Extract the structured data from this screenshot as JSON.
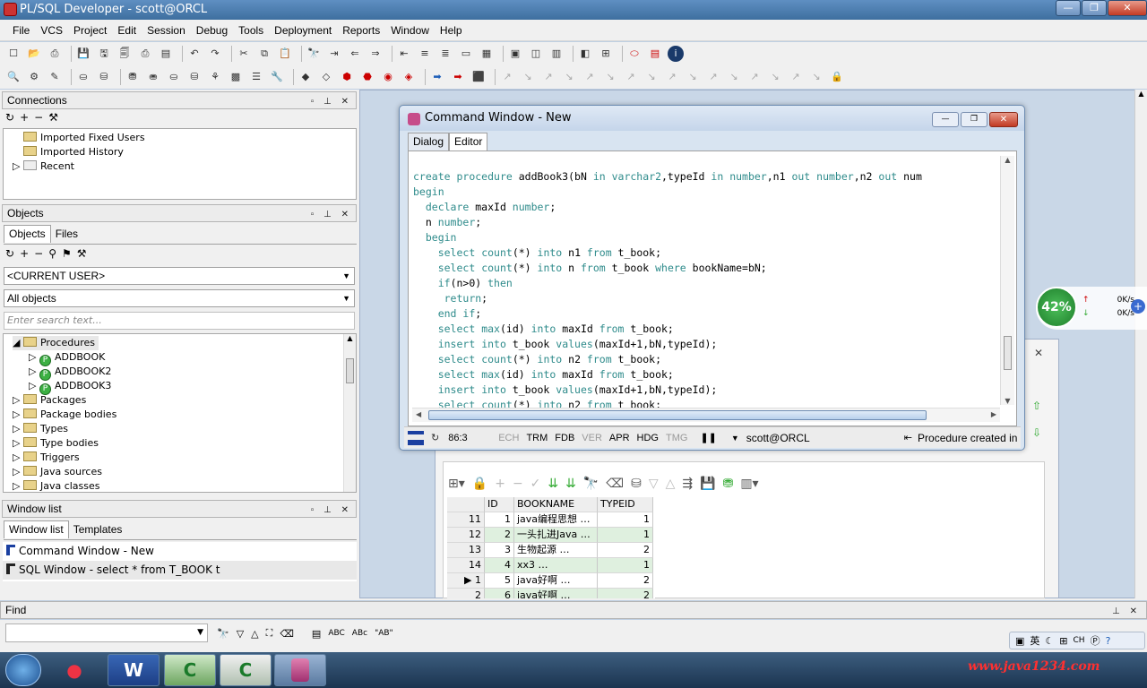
{
  "app": {
    "title": "PL/SQL Developer - scott@ORCL"
  },
  "menu": [
    "File",
    "VCS",
    "Project",
    "Edit",
    "Session",
    "Debug",
    "Tools",
    "Deployment",
    "Reports",
    "Window",
    "Help"
  ],
  "connections": {
    "title": "Connections",
    "items": [
      "Imported Fixed Users",
      "Imported History",
      "Recent"
    ]
  },
  "objects": {
    "title": "Objects",
    "tabs": [
      "Objects",
      "Files"
    ],
    "user_select": "<CURRENT USER>",
    "filter_select": "All objects",
    "search_placeholder": "Enter search text...",
    "tree": {
      "procedures": "Procedures",
      "children": [
        "ADDBOOK",
        "ADDBOOK2",
        "ADDBOOK3"
      ],
      "others": [
        "Packages",
        "Package bodies",
        "Types",
        "Type bodies",
        "Triggers",
        "Java sources",
        "Java classes"
      ]
    }
  },
  "window_list": {
    "title": "Window list",
    "tabs": [
      "Window list",
      "Templates"
    ],
    "items": [
      "Command Window - New",
      "SQL Window - select * from T_BOOK t"
    ]
  },
  "find": {
    "title": "Find",
    "buttons": [
      "ABC",
      "ABc",
      "\"AB\""
    ]
  },
  "command_window": {
    "title": "Command Window - New",
    "tabs": [
      "Dialog",
      "Editor"
    ],
    "code": [
      "create procedure addBook3(bN in varchar2,typeId in number,n1 out number,n2 out num",
      "begin",
      "  declare maxId number;",
      "  n number;",
      "  begin",
      "    select count(*) into n1 from t_book;",
      "    select count(*) into n from t_book where bookName=bN;",
      "    if(n>0) then",
      "     return;",
      "    end if;",
      "    select max(id) into maxId from t_book;",
      "    insert into t_book values(maxId+1,bN,typeId);",
      "    select count(*) into n2 from t_book;",
      "    select max(id) into maxId from t_book;",
      "    insert into t_book values(maxId+1,bN,typeId);",
      "    select count(*) into n2 from t_book;"
    ],
    "status": {
      "position": "86:3",
      "flags": [
        "ECH",
        "TRM",
        "FDB",
        "VER",
        "APR",
        "HDG",
        "TMG"
      ],
      "connection": "scott@ORCL",
      "message": "Procedure created in"
    }
  },
  "results": {
    "columns": [
      "",
      "ID",
      "BOOKNAME",
      "TYPEID"
    ],
    "rows": [
      {
        "n": "11",
        "id": "1",
        "name": "java编程思想",
        "type": "1"
      },
      {
        "n": "12",
        "id": "2",
        "name": "一头扎进Java",
        "type": "1"
      },
      {
        "n": "13",
        "id": "3",
        "name": "生物起源",
        "type": "2"
      },
      {
        "n": "14",
        "id": "4",
        "name": "xx3",
        "type": "1"
      },
      {
        "n": "1",
        "id": "5",
        "name": "java好啊",
        "type": "2"
      },
      {
        "n": "2",
        "id": "6",
        "name": "java好啊",
        "type": "2"
      }
    ]
  },
  "net_widget": {
    "percent": "42%",
    "up": "0K/s",
    "down": "0K/s"
  },
  "tray": {
    "lang": "英",
    "ime": "CH",
    "watermark": "www.java1234.com"
  },
  "taskbar": {
    "apps": [
      "W",
      "C",
      "C",
      ""
    ]
  },
  "colors": {
    "keyword": "#2e8b8b",
    "selected_row": "#dff0df"
  }
}
